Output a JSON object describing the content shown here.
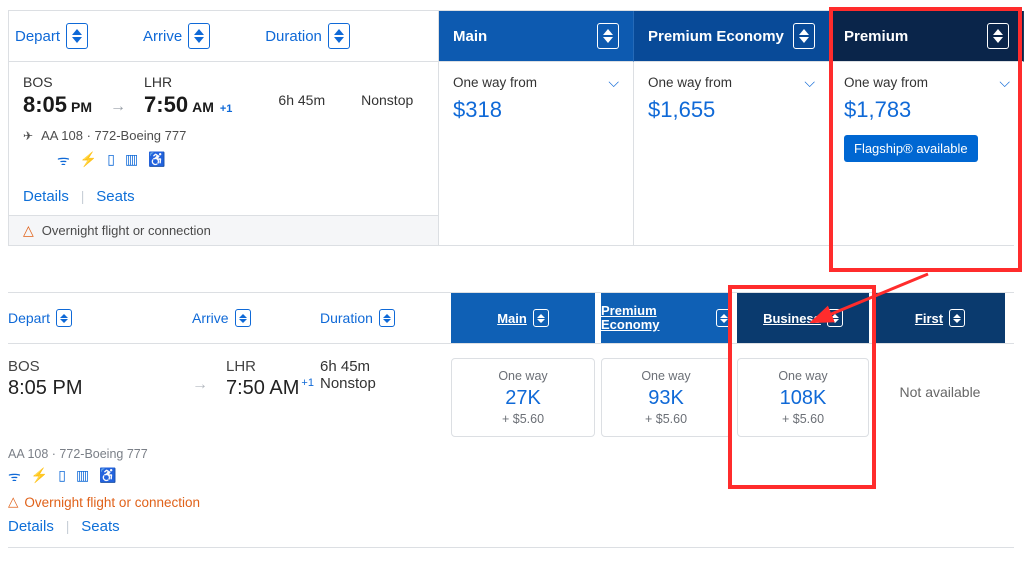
{
  "sort": {
    "depart": "Depart",
    "arrive": "Arrive",
    "duration": "Duration"
  },
  "fare_headers": {
    "main": "Main",
    "premium_economy": "Premium Economy",
    "premium": "Premium"
  },
  "flight1": {
    "dep_code": "BOS",
    "dep_time": "8:05",
    "dep_ampm": "PM",
    "arr_code": "LHR",
    "arr_time": "7:50",
    "arr_ampm": "AM",
    "plus": "+1",
    "duration": "6h 45m",
    "type": "Nonstop",
    "meta": "AA 108 · 772-Boeing 777",
    "details": "Details",
    "seats": "Seats",
    "warn": "Overnight flight or connection"
  },
  "prices1": {
    "owf": "One way from",
    "main": "$318",
    "pe": "$1,655",
    "premium": "$1,783",
    "flagship": "Flagship® available"
  },
  "sort2": {
    "depart": "Depart",
    "arrive": "Arrive",
    "duration": "Duration"
  },
  "fare_headers2": {
    "main": "Main",
    "pe": "Premium Economy",
    "biz": "Business",
    "first": "First"
  },
  "flight2": {
    "dep_code": "BOS",
    "dep_time": "8:05 PM",
    "arr_code": "LHR",
    "arr_time": "7:50 AM",
    "plus": "+1",
    "duration": "6h 45m",
    "type": "Nonstop",
    "meta": "AA 108 · 772-Boeing 777",
    "warn": "Overnight flight or connection",
    "details": "Details",
    "seats": "Seats"
  },
  "cards2": {
    "ow": "One way",
    "main": {
      "pts": "27K",
      "tax": "+ $5.60"
    },
    "pe": {
      "pts": "93K",
      "tax": "+ $5.60"
    },
    "biz": {
      "pts": "108K",
      "tax": "+ $5.60"
    },
    "first": "Not available"
  }
}
